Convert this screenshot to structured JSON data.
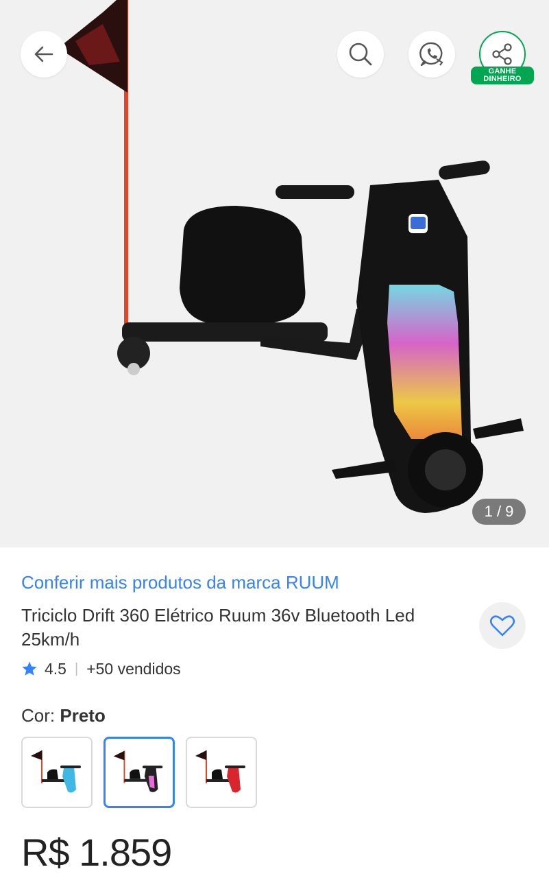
{
  "header": {
    "share_badge": "GANHE DINHEIRO"
  },
  "gallery": {
    "counter": "1 / 9"
  },
  "product": {
    "brand_link": "Conferir mais produtos da marca RUUM",
    "title": "Triciclo Drift 360 Elétrico Ruum 36v Bluetooth Led 25km/h",
    "rating": "4.5",
    "sold": "+50 vendidos",
    "color_label": "Cor:",
    "color_value": "Preto",
    "price": "R$ 1.859",
    "variants": [
      {
        "color": "#3fb8e3"
      },
      {
        "color": "#222222"
      },
      {
        "color": "#d8262c"
      }
    ]
  },
  "colors": {
    "accent": "#3483fa",
    "share_green": "#00a650",
    "star": "#3483fa"
  }
}
